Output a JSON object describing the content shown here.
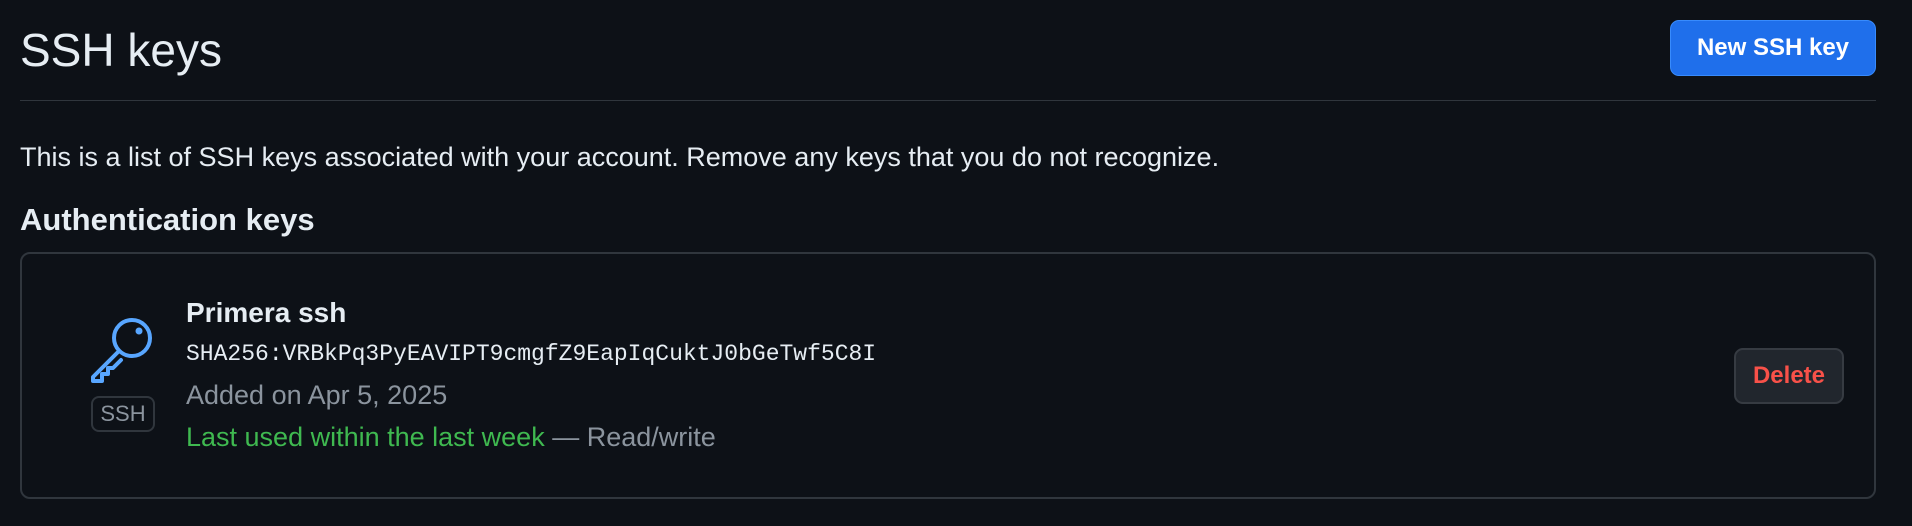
{
  "header": {
    "title": "SSH keys",
    "new_key_label": "New SSH key"
  },
  "intro": "This is a list of SSH keys associated with your account. Remove any keys that you do not recognize.",
  "section_title": "Authentication keys",
  "keys": [
    {
      "icon": "key-icon",
      "badge": "SSH",
      "name": "Primera ssh",
      "fingerprint": "SHA256:VRBkPq3PyEAVIPT9cmgfZ9EapIqCuktJ0bGeTwf5C8I",
      "added_on": "Added on Apr 5, 2025",
      "last_used": "Last used within the last week",
      "access": " — Read/write",
      "delete_label": "Delete"
    }
  ],
  "colors": {
    "background": "#0d1117",
    "primary_button": "#1f6feb",
    "danger": "#f85149",
    "success": "#3fb950",
    "muted": "#8b949e",
    "icon_accent": "#58a6ff"
  }
}
